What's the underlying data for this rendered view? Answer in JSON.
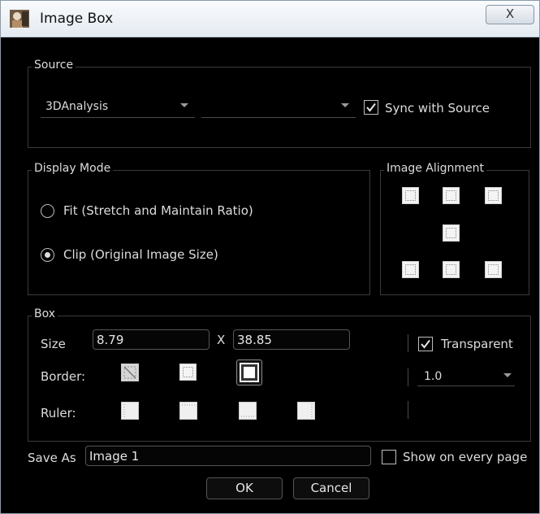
{
  "window": {
    "title": "Image Box",
    "close_glyph": "X"
  },
  "source": {
    "legend": "Source",
    "source_value": "3DAnalysis",
    "secondary_value": "",
    "sync_label": "Sync with Source",
    "sync_checked": true
  },
  "display_mode": {
    "legend": "Display Mode",
    "options": [
      {
        "label": "Fit (Stretch and Maintain Ratio)",
        "selected": false
      },
      {
        "label": "Clip (Original Image Size)",
        "selected": true
      }
    ]
  },
  "image_alignment": {
    "legend": "Image Alignment",
    "options": [
      "top-left",
      "top-center",
      "top-right",
      "center",
      "bottom-left",
      "bottom-center",
      "bottom-right"
    ]
  },
  "box": {
    "legend": "Box",
    "size_label": "Size",
    "width": "8.79",
    "x_label": "X",
    "height": "38.85",
    "border_label": "Border:",
    "ruler_label": "Ruler:",
    "transparent_label": "Transparent",
    "transparent_checked": true,
    "border_width": "1.0"
  },
  "save_as": {
    "label": "Save As",
    "value": "Image 1",
    "show_every_page_label": "Show on every page",
    "show_every_page_checked": false
  },
  "buttons": {
    "ok": "OK",
    "cancel": "Cancel"
  },
  "colors": {
    "background": "#000000",
    "titlebar": "#e9eef4",
    "text": "#dcdcdc"
  }
}
